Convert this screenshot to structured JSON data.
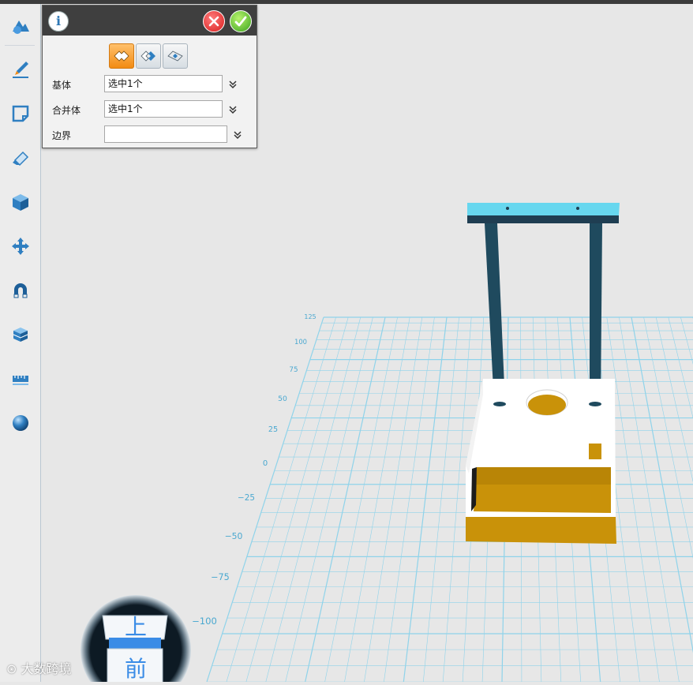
{
  "toolbar": {
    "tools": [
      {
        "name": "basic-shapes-icon"
      },
      {
        "name": "sketch-pen-icon"
      },
      {
        "name": "sketch-edit-icon"
      },
      {
        "name": "eraser-icon"
      },
      {
        "name": "solid-cube-icon"
      },
      {
        "name": "move-arrows-icon"
      },
      {
        "name": "magnet-icon"
      },
      {
        "name": "group-box-icon"
      },
      {
        "name": "measure-ruler-icon"
      },
      {
        "name": "material-sphere-icon"
      }
    ]
  },
  "dialog": {
    "info_icon": "i",
    "modes": [
      "union",
      "subtract",
      "intersect"
    ],
    "active_mode": "union",
    "fields": {
      "base": {
        "label": "基体",
        "value": "选中1个"
      },
      "merge": {
        "label": "合并体",
        "value": "选中1个"
      },
      "boundary": {
        "label": "边界",
        "value": ""
      }
    }
  },
  "grid": {
    "axis_labels": [
      "125",
      "100",
      "75",
      "50",
      "25",
      "0",
      "−25",
      "−50",
      "−75",
      "−100"
    ],
    "line_color": "#8fd3ea",
    "label_color": "#4aa8d0"
  },
  "model": {
    "body_color": "#ffffff",
    "cavity_color": "#c8900a",
    "pillar_color": "#1f4a5e",
    "top_bar_color": "#67d7ef"
  },
  "nav_cube": {
    "top_face": "上",
    "front_face": "前"
  },
  "watermark": {
    "text": "大数跨境"
  },
  "colors": {
    "accent": "#f28b13",
    "cancel": "#d81e1e",
    "confirm": "#3aa21d",
    "icon_blue": "#2f7fc1"
  }
}
